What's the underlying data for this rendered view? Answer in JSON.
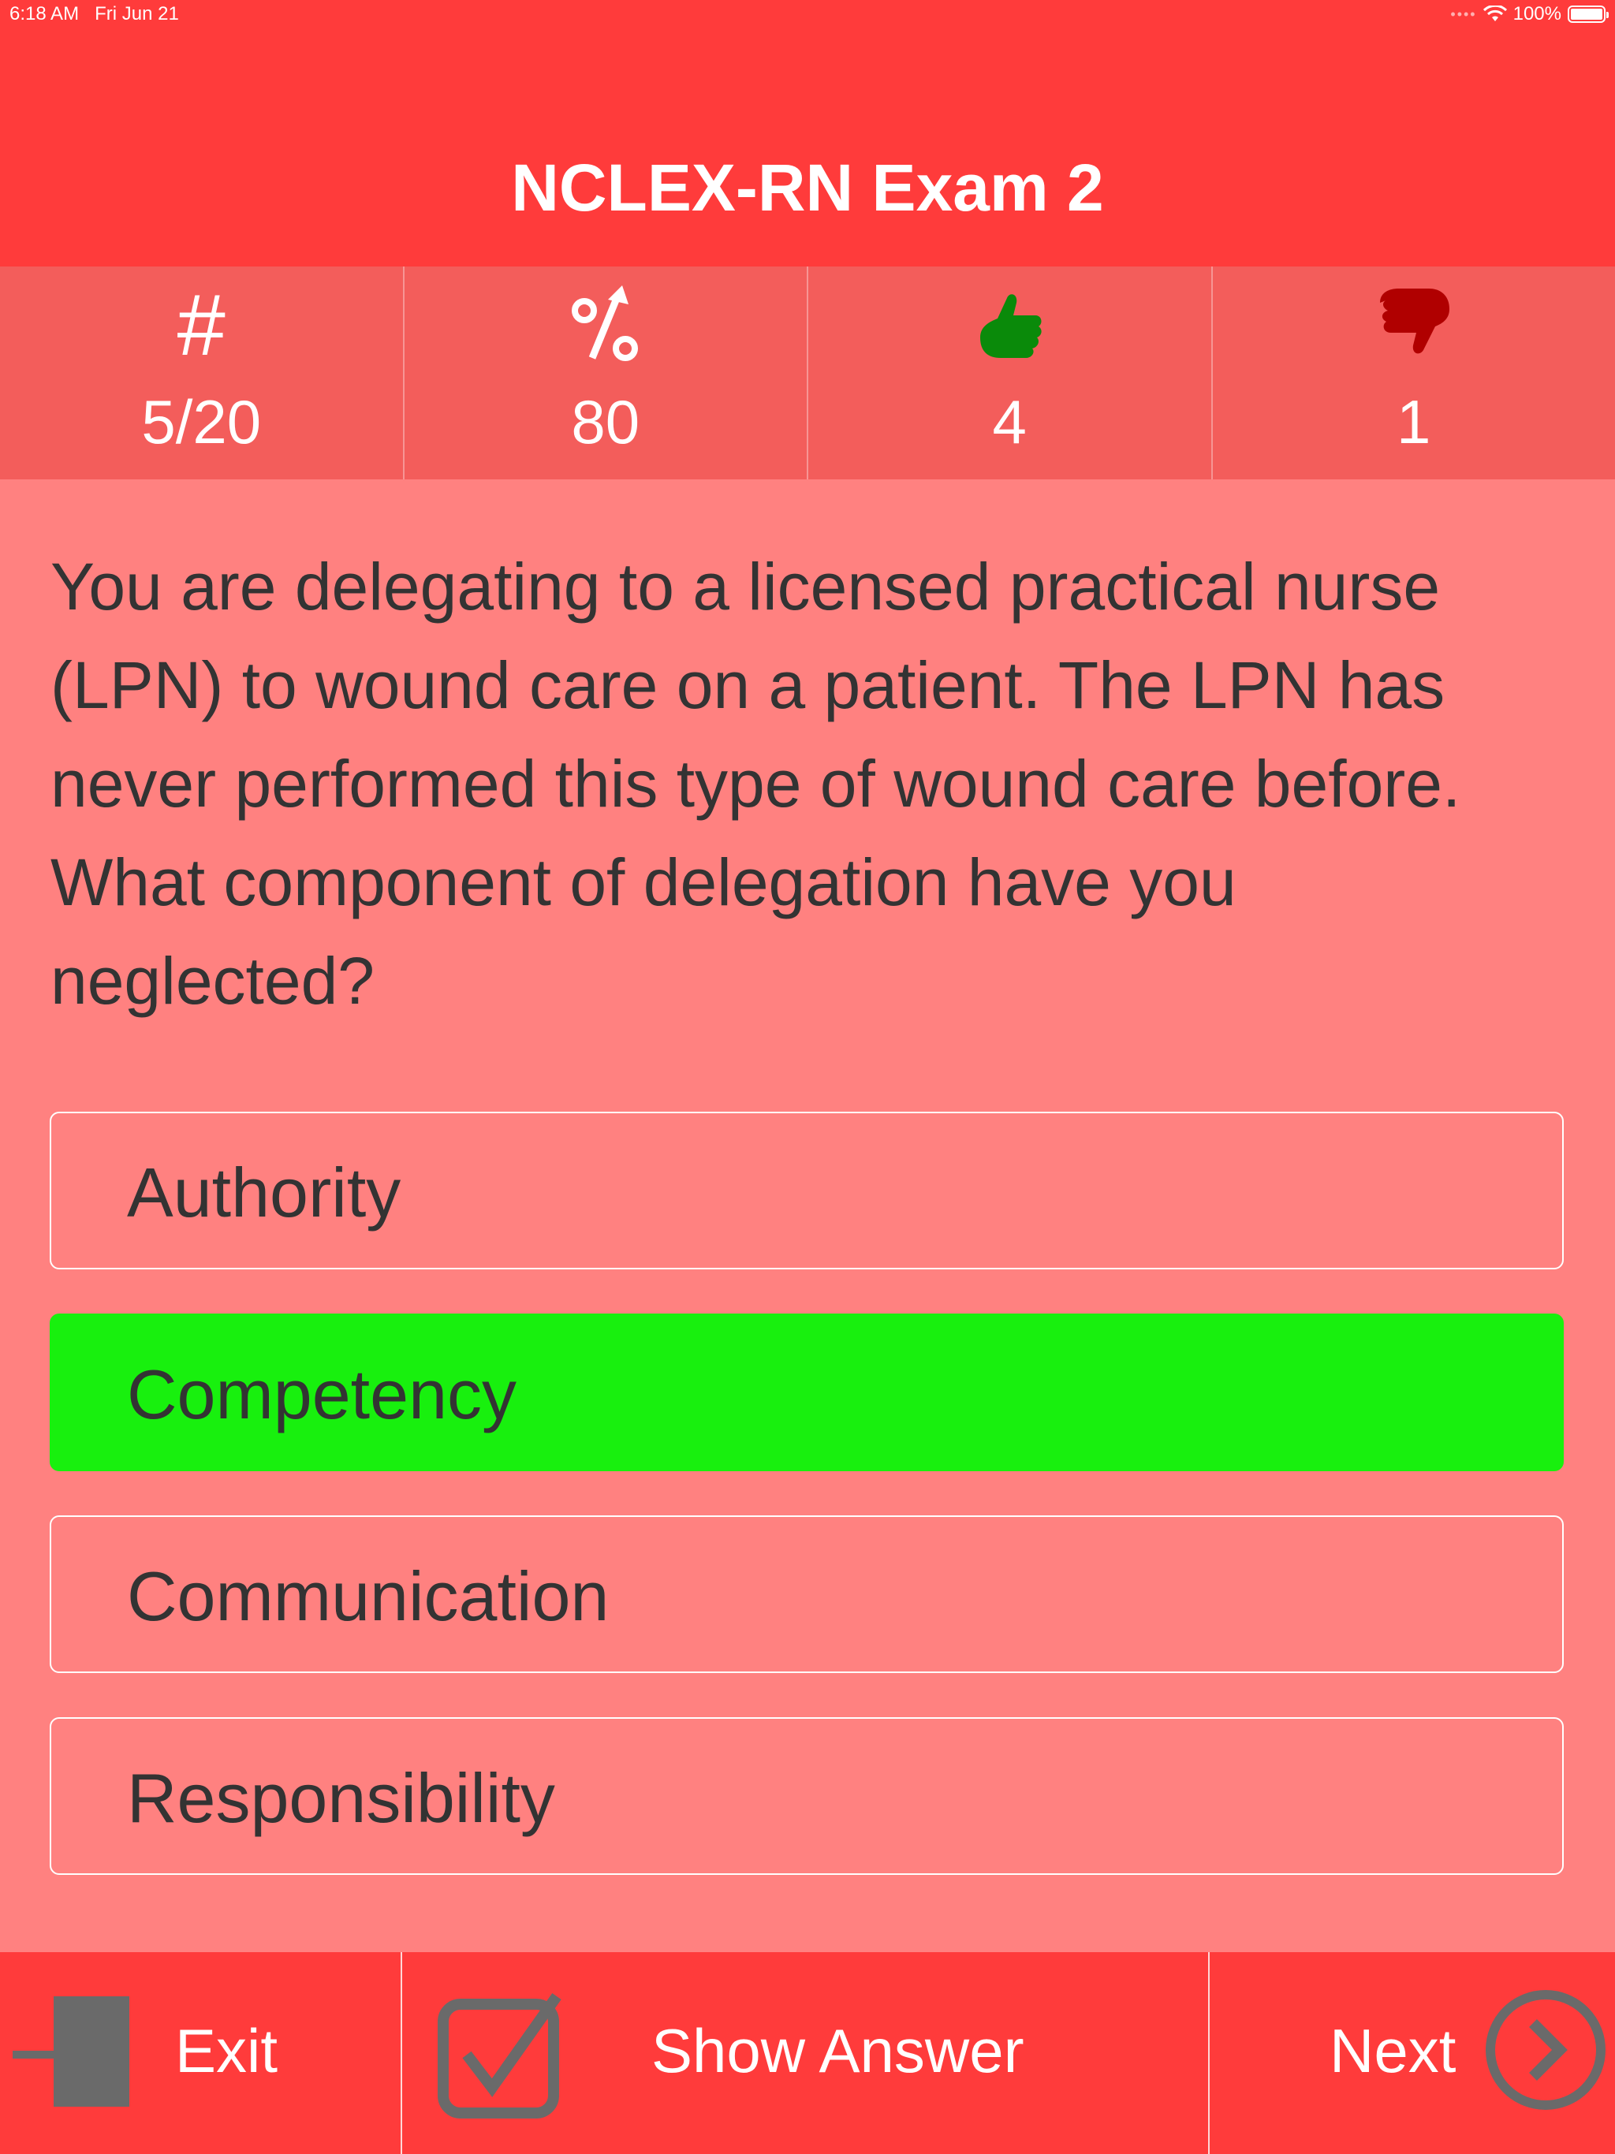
{
  "status_bar": {
    "time": "6:18 AM",
    "date": "Fri Jun 21",
    "battery": "100%"
  },
  "header": {
    "title": "NCLEX-RN Exam 2"
  },
  "stats": [
    {
      "icon": "hash-icon",
      "symbol": "#",
      "value": "5/20"
    },
    {
      "icon": "percent-icon",
      "symbol": "%",
      "value": "80"
    },
    {
      "icon": "thumbs-up-icon",
      "value": "4"
    },
    {
      "icon": "thumbs-down-icon",
      "value": "1"
    }
  ],
  "question": {
    "text": "You are delegating to a licensed practical nurse (LPN) to wound care on a patient. The LPN has never performed this type of wound care before. What component of delegation have you neglected?"
  },
  "answers": [
    {
      "label": "Authority",
      "state": "default"
    },
    {
      "label": "Competency",
      "state": "correct"
    },
    {
      "label": "Communication",
      "state": "default"
    },
    {
      "label": "Responsibility",
      "state": "default"
    }
  ],
  "toolbar": {
    "exit_label": "Exit",
    "show_answer_label": "Show Answer",
    "next_label": "Next"
  },
  "colors": {
    "header": "#ff3b3b",
    "stats_bg": "#f35d5b",
    "page_bg": "#ff8180",
    "correct": "#18f00e",
    "thumbs_up": "#0a8a0a",
    "thumbs_down": "#b00000"
  }
}
